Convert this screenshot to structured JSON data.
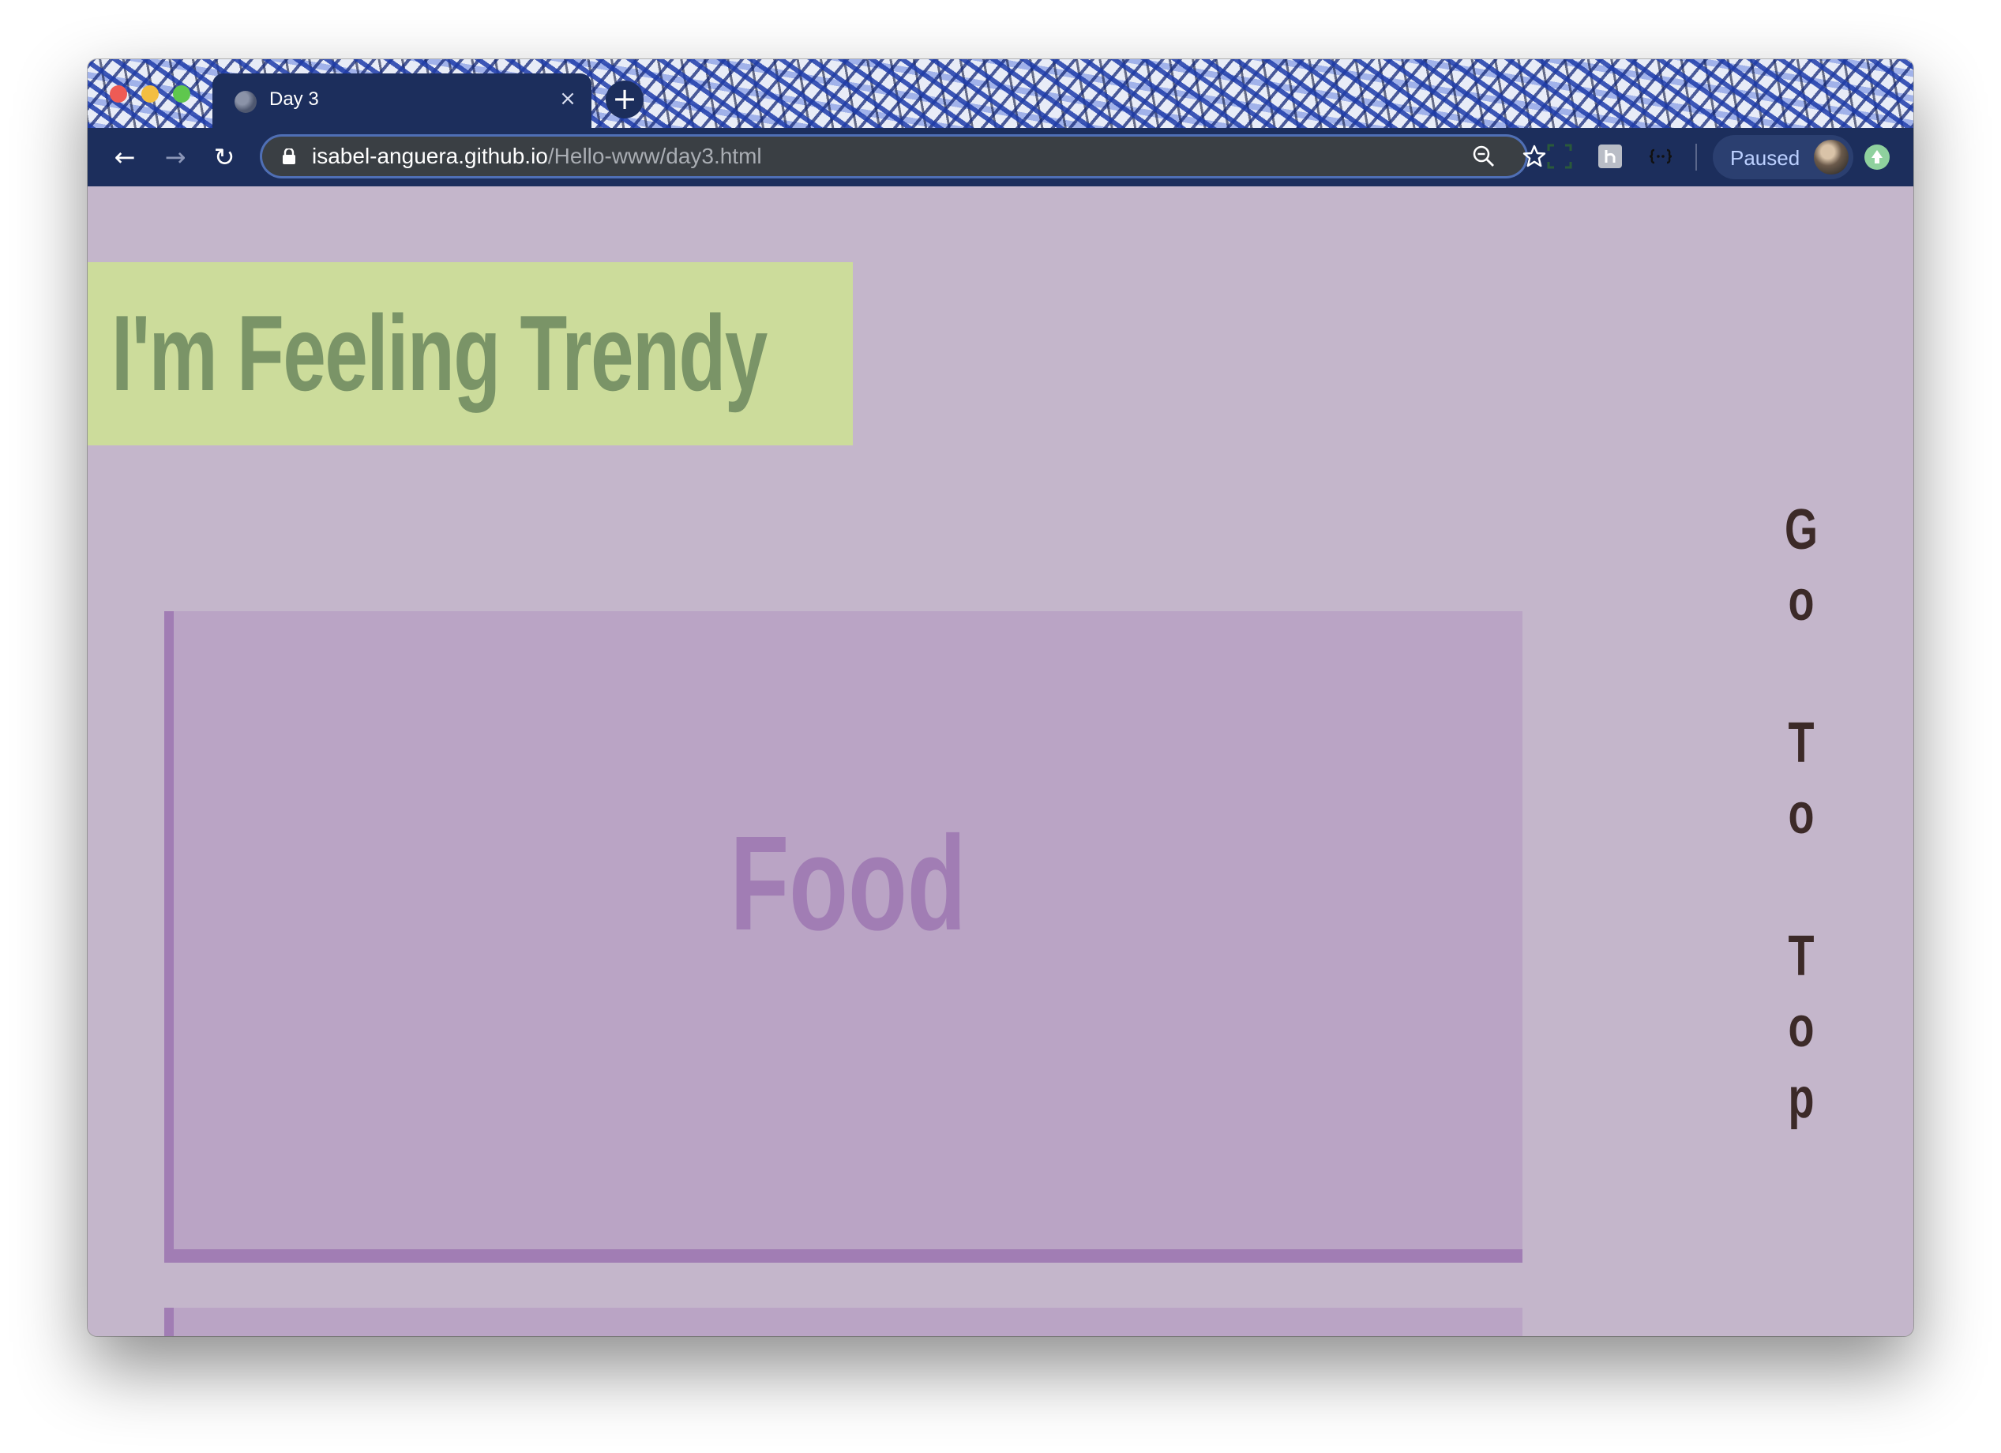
{
  "browser": {
    "tab": {
      "title": "Day 3",
      "close_glyph": "×"
    },
    "new_tab_glyph": "+",
    "nav": {
      "back_glyph": "←",
      "forward_glyph": "→",
      "reload_glyph": "↻"
    },
    "address_bar": {
      "host": "isabel-anguera.github.io",
      "path": "/Hello-www/day3.html"
    },
    "profile": {
      "status": "Paused"
    },
    "icons": [
      "lock-icon",
      "zoom-icon",
      "star-icon",
      "screenshot-extension-icon",
      "extension-icon",
      "json-extension-icon",
      "avatar",
      "update-icon"
    ]
  },
  "page": {
    "hero_title": "I'm Feeling Trendy",
    "sections": [
      {
        "title": "Food"
      },
      {
        "title": ""
      }
    ],
    "go_to_top_letters": [
      "G",
      "o",
      "",
      "T",
      "o",
      "",
      "T",
      "o",
      "p"
    ]
  },
  "colors": {
    "page_background": "#c4b6cb",
    "hero_background": "#ccdc9b",
    "hero_text": "#7a9467",
    "section_background": "#baa4c5",
    "section_accent": "#a17db4",
    "go_to_top_text": "#3c2a28",
    "browser_chrome": "#1c2e5c"
  }
}
